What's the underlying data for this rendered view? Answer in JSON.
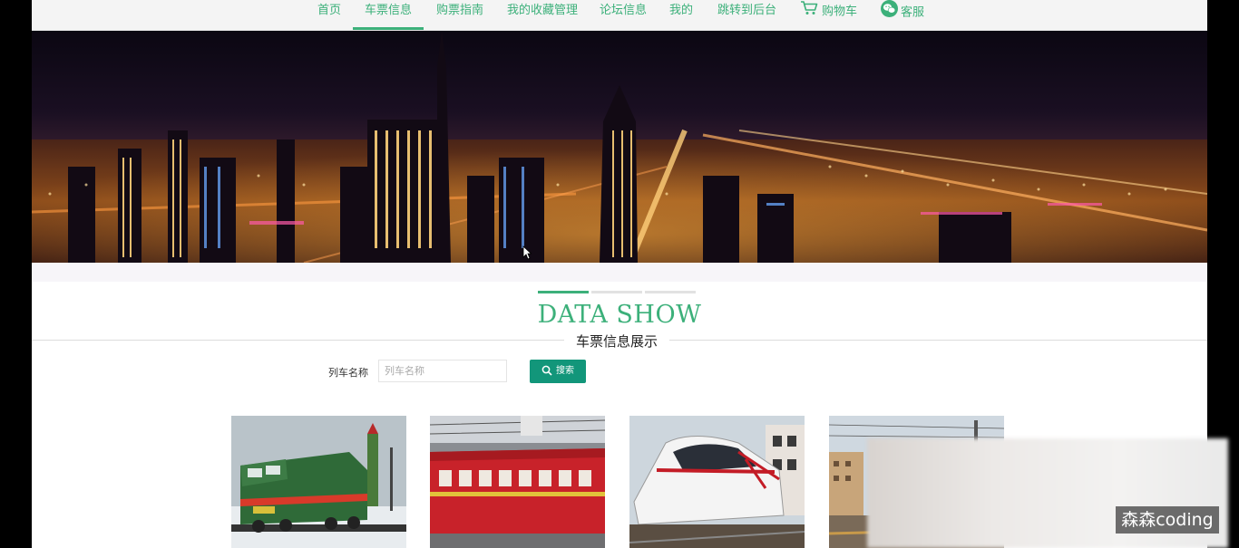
{
  "nav": {
    "items": [
      {
        "label": "首页"
      },
      {
        "label": "车票信息",
        "active": true
      },
      {
        "label": "购票指南"
      },
      {
        "label": "我的收藏管理"
      },
      {
        "label": "论坛信息"
      },
      {
        "label": "我的"
      },
      {
        "label": "跳转到后台"
      },
      {
        "label": "购物车",
        "icon": "cart-icon"
      },
      {
        "label": "客服",
        "icon": "wechat-icon"
      }
    ]
  },
  "banner": {
    "image": "night-city-skyline"
  },
  "section": {
    "title": "DATA SHOW",
    "subtitle": "车票信息展示"
  },
  "search": {
    "label": "列车名称",
    "placeholder": "列车名称",
    "value": "",
    "button_label": "搜索",
    "button_icon": "search-icon"
  },
  "cards": [
    {
      "image": "green-diesel-locomotive"
    },
    {
      "image": "red-passenger-train"
    },
    {
      "image": "white-metro-train-ribbon"
    },
    {
      "image": "electrified-railway-station"
    }
  ],
  "watermark": "森森coding",
  "colors": {
    "accent": "#3cb07a",
    "button": "#12967a",
    "nav_bg": "#f4f4f4",
    "page_bg": "#000000"
  }
}
